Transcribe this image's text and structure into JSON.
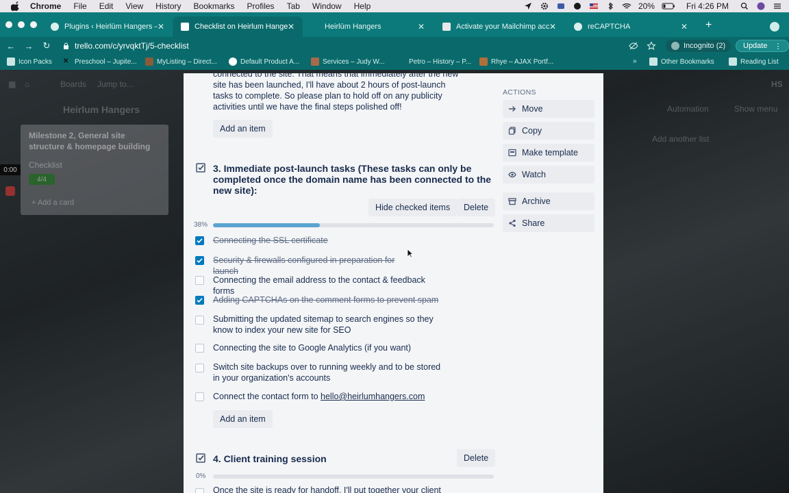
{
  "menubar": {
    "app": "Chrome",
    "items": [
      "File",
      "Edit",
      "View",
      "History",
      "Bookmarks",
      "Profiles",
      "Tab",
      "Window",
      "Help"
    ],
    "battery": "20%",
    "clock": "Fri 4:26 PM"
  },
  "tabs": [
    {
      "title": "Plugins ‹ Heirlūm Hangers — W",
      "active": false
    },
    {
      "title": "Checklist on Heirlum Hangers",
      "active": true
    },
    {
      "title": "Heirlūm Hangers",
      "active": false
    },
    {
      "title": "Activate your Mailchimp accou",
      "active": false
    },
    {
      "title": "reCAPTCHA",
      "active": false
    }
  ],
  "toolbar": {
    "url": "trello.com/c/yrvqktTj/5-checklist",
    "incognito": "Incognito (2)",
    "update": "Update"
  },
  "bookmarks": {
    "items": [
      "Icon Packs",
      "Preschool – Jupite...",
      "MyListing – Direct...",
      "Default Product A...",
      "Services – Judy W...",
      "Petro – History – P...",
      "Rhye – AJAX Portf..."
    ],
    "more": "»",
    "other": "Other Bookmarks",
    "reading": "Reading List"
  },
  "board": {
    "list_title": "Milestone 2, General site structure & homepage building",
    "card_label": "Checklist",
    "badge": "4/4",
    "add_card": "Add a card",
    "timer": "0:00",
    "bg_boards": "Boards",
    "bg_jump": "Jump to...",
    "bg_board_name": "Heirlum Hangers",
    "bg_automation": "Automation",
    "bg_show_menu": "Show menu",
    "bg_add_list": "Add another list",
    "bg_avatar": "HS"
  },
  "card": {
    "prev_text_lines": [
      "connected to the site. That means that immediately after the new",
      "site has been launched, I'll have about 2 hours of post-launch",
      "tasks to complete. So please plan to hold off on any publicity",
      "activities until we have the final steps polished off!"
    ],
    "add_item_label": "Add an item",
    "checklist3": {
      "title": "3. Immediate post-launch tasks (These tasks can only be completed once the domain name has been connected to the new site):",
      "hide_checked": "Hide checked items",
      "delete": "Delete",
      "percent_label": "38%",
      "progress": 0.38,
      "items": [
        {
          "text": "Connecting the SSL certificate",
          "checked": true
        },
        {
          "text": "Security & firewalls configured in preparation for launch",
          "checked": true
        },
        {
          "text": "Connecting the email address to the contact & feedback forms",
          "checked": false
        },
        {
          "text": "Adding CAPTCHAs on the comment forms to prevent spam",
          "checked": true
        },
        {
          "text": "Submitting the updated sitemap to search engines so they know to index your new site for SEO",
          "checked": false
        },
        {
          "text": "Connecting the site to Google Analytics (if you want)",
          "checked": false
        },
        {
          "text": "Switch site backups over to running weekly and to be stored in your organization's accounts",
          "checked": false
        },
        {
          "text": "Connect the contact form to ",
          "link": "hello@heirlumhangers.com",
          "checked": false
        }
      ]
    },
    "checklist4": {
      "title": "4. Client training session",
      "delete": "Delete",
      "percent_label": "0%",
      "progress": 0,
      "first_item": "Once the site is ready for handoff, I'll put together your client"
    },
    "actions": {
      "label": "ACTIONS",
      "items": [
        "Move",
        "Copy",
        "Make template",
        "Watch",
        "Archive",
        "Share"
      ]
    }
  }
}
